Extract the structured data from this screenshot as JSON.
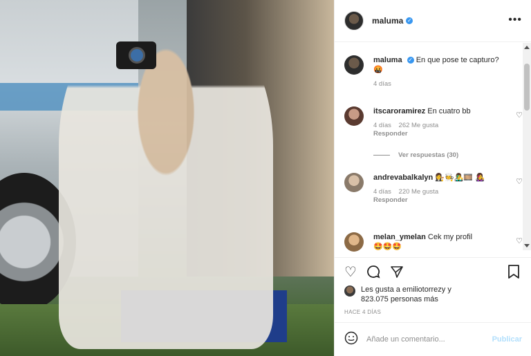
{
  "post": {
    "username": "maluma",
    "more_icon": "more-horizontal-icon"
  },
  "caption": {
    "username": "maluma",
    "text": "En que pose te capturo?",
    "emoji": "🤬",
    "time": "4 días"
  },
  "comments": [
    {
      "username": "itscaroramirez",
      "text": "En cuatro bb",
      "time": "4 días",
      "likes": "262 Me gusta",
      "reply": "Responder",
      "view_replies": "Ver respuestas (30)"
    },
    {
      "username": "andrevabalkalyn",
      "text": "👩‍⚖️🧑‍🍳👨‍🎤🎞️ 👩‍🎤",
      "time": "4 días",
      "likes": "220 Me gusta",
      "reply": "Responder"
    },
    {
      "username": "melan_ymelan",
      "text": "Cek my profil",
      "emoji": "🤩🤩🤩"
    }
  ],
  "actions": {
    "like_icon": "heart-icon",
    "comment_icon": "comment-icon",
    "share_icon": "paper-plane-icon",
    "save_icon": "bookmark-icon"
  },
  "likes": {
    "line1": "Les gusta a emiliotorrezy y",
    "line2": "823.075 personas más"
  },
  "timestamp": "HACE 4 DÍAS",
  "add_comment": {
    "placeholder": "Añade un comentario...",
    "post_label": "Publicar"
  },
  "colors": {
    "verified": "#3897f0",
    "post_button": "#b2dffc",
    "meta_gray": "#8e8e8e"
  }
}
